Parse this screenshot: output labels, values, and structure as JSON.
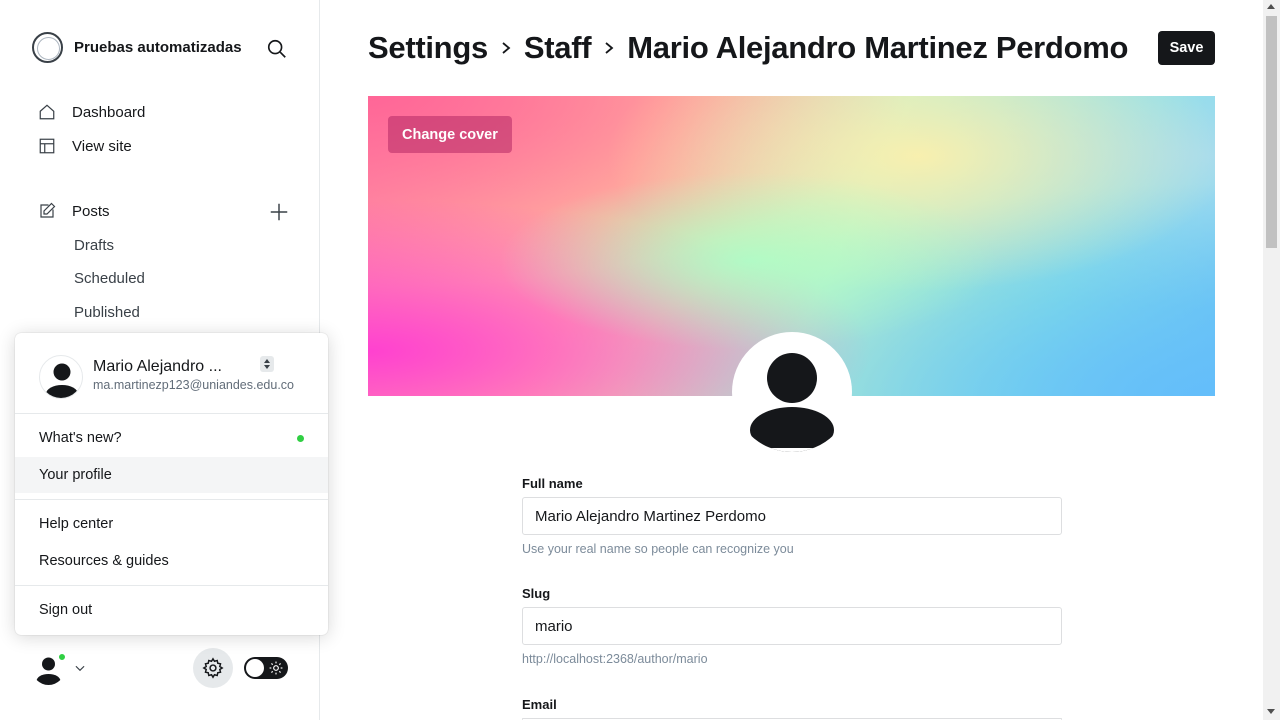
{
  "sidebar": {
    "site_name": "Pruebas automatizadas",
    "nav": {
      "dashboard": "Dashboard",
      "view_site": "View site",
      "posts": "Posts",
      "drafts": "Drafts",
      "scheduled": "Scheduled",
      "published": "Published"
    }
  },
  "user_menu": {
    "name": "Mario Alejandro ...",
    "email": "ma.martinezp123@uniandes.edu.co",
    "items": {
      "whats_new": "What's new?",
      "your_profile": "Your profile",
      "help_center": "Help center",
      "resources": "Resources & guides",
      "sign_out": "Sign out"
    },
    "status_dot_color": "#30cf43"
  },
  "header": {
    "breadcrumb": [
      "Settings",
      "Staff",
      "Mario Alejandro Martinez Perdomo"
    ],
    "save_label": "Save"
  },
  "cover": {
    "change_cover_label": "Change cover"
  },
  "form": {
    "full_name": {
      "label": "Full name",
      "value": "Mario Alejandro Martinez Perdomo",
      "hint": "Use your real name so people can recognize you"
    },
    "slug": {
      "label": "Slug",
      "value": "mario",
      "hint": "http://localhost:2368/author/mario"
    },
    "email": {
      "label": "Email"
    }
  },
  "colors": {
    "primary_dark": "#15171a",
    "accent_green": "#30cf43"
  }
}
